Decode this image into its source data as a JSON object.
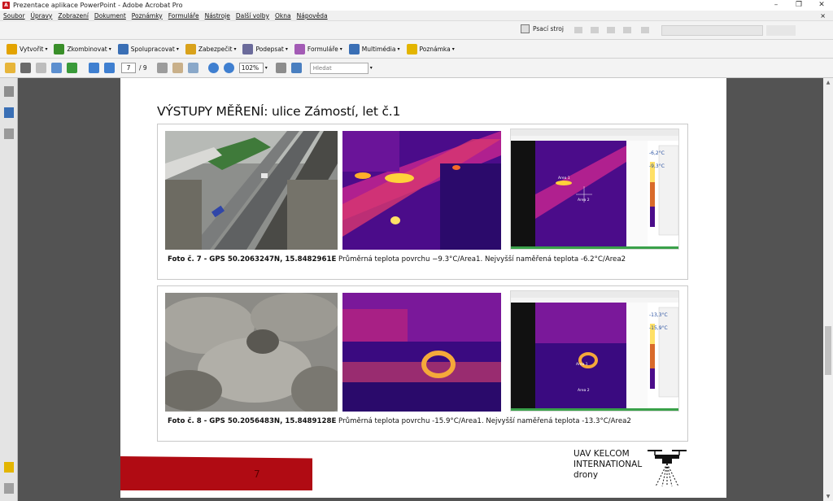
{
  "window": {
    "title": "Prezentace aplikace PowerPoint - Adobe Acrobat Pro",
    "controls": [
      "–",
      "❐",
      "✕"
    ]
  },
  "menu": {
    "items": [
      "Soubor",
      "Úpravy",
      "Zobrazení",
      "Dokument",
      "Poznámky",
      "Formuláře",
      "Nástroje",
      "Další volby",
      "Okna",
      "Nápověda"
    ],
    "close": "×"
  },
  "toolbar_top": {
    "typewriter_label": "Psací stroj"
  },
  "toolbar_tasks": [
    {
      "label": "Vytvořit",
      "icon": "create-pdf-icon",
      "color": "#e3a300"
    },
    {
      "label": "Zkombinovat",
      "icon": "combine-icon",
      "color": "#3a8f2a"
    },
    {
      "label": "Spolupracovat",
      "icon": "collaborate-icon",
      "color": "#3a6fb5"
    },
    {
      "label": "Zabezpečit",
      "icon": "lock-icon",
      "color": "#d9a21b"
    },
    {
      "label": "Podepsat",
      "icon": "pen-icon",
      "color": "#6b6b9b"
    },
    {
      "label": "Formuláře",
      "icon": "forms-icon",
      "color": "#a35bb5"
    },
    {
      "label": "Multimédia",
      "icon": "multimedia-icon",
      "color": "#3a6fb5"
    },
    {
      "label": "Poznámka",
      "icon": "comment-icon",
      "color": "#e3b500"
    }
  ],
  "nav": {
    "current_page": "7",
    "total_pages": "/ 9",
    "zoom": "102%",
    "search_placeholder": "Hledat"
  },
  "slide": {
    "title": "VÝSTUPY MĚŘENÍ: ulice Zámostí, let č.1",
    "photo7": {
      "caption_bold": "Foto č. 7 - GPS 50.2063247N, 15.8482961E",
      "caption_text": " Průměrná teplota povrchu −9.3°C/Area1.  Nejvyšší naměřená teplota -6.2°C/Area2",
      "app_labels": [
        "-6,2°C",
        "-9,3°C"
      ],
      "area_labels": [
        "Area 1",
        "Area 2"
      ]
    },
    "photo8": {
      "caption_bold": "Foto č. 8 - GPS 50.2056483N, 15.8489128E",
      "caption_text": " Průměrná teplota povrchu -15.9°C/Area1.  Nejvyšší naměřená teplota -13.3°C/Area2",
      "app_labels": [
        "-13,3°C",
        "-15,9°C"
      ],
      "area_labels": [
        "Area 1",
        "Area 2"
      ]
    },
    "slide_number": "7",
    "logo_lines": [
      "UAV KELCOM",
      "INTERNATIONAL",
      "drony"
    ]
  },
  "colors": {
    "accent_red": "#b00b13",
    "thermal_dark": "#2a0a6a",
    "thermal_hot": "#ffcf3a"
  }
}
